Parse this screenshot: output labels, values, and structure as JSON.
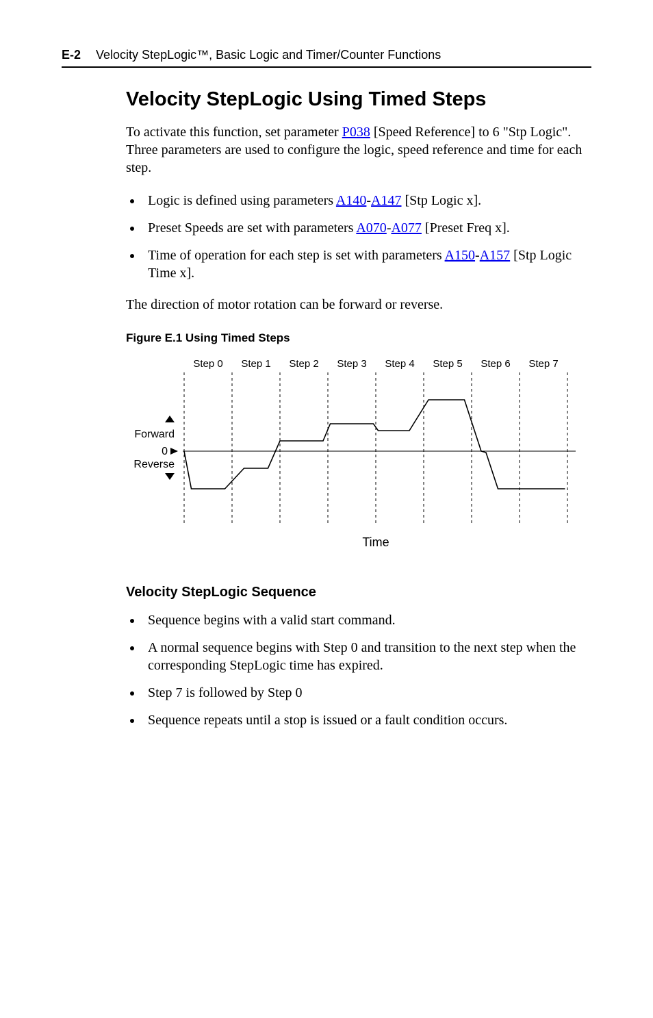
{
  "header": {
    "page_num": "E-2",
    "running_title": "Velocity StepLogic™, Basic Logic and Timer/Counter Functions"
  },
  "title": "Velocity StepLogic Using Timed Steps",
  "intro": {
    "pre": "To activate this function, set parameter ",
    "link1": "P038",
    "mid": " [Speed Reference] to 6 \"Stp Logic\". Three parameters are used to configure the logic, speed reference and time for each step."
  },
  "bullets1": {
    "b1_pre": "Logic is defined using parameters ",
    "b1_l1": "A140",
    "b1_dash1": "-",
    "b1_l2": "A147",
    "b1_post": " [Stp Logic x].",
    "b2_pre": "Preset Speeds are set with parameters ",
    "b2_l1": "A070",
    "b2_dash1": "-",
    "b2_l2": "A077",
    "b2_post": " [Preset Freq x].",
    "b3_pre": "Time of operation for each step is set with parameters ",
    "b3_l1": "A150",
    "b3_dash1": "-",
    "b3_l2": "A157",
    "b3_post": " [Stp Logic Time x]."
  },
  "direction_note": "The direction of motor rotation can be forward or reverse.",
  "figcap": "Figure E.1  Using Timed Steps",
  "chart_data": {
    "type": "line",
    "x_label": "Time",
    "y_labels": {
      "up": "Forward",
      "zero": "0",
      "down": "Reverse"
    },
    "steps": [
      "Step 0",
      "Step 1",
      "Step 2",
      "Step 3",
      "Step 4",
      "Step 5",
      "Step 6",
      "Step 7"
    ],
    "boundaries": [
      0,
      1,
      2,
      3,
      4,
      5,
      6,
      7,
      8
    ],
    "segments": [
      {
        "from": [
          0.0,
          0
        ],
        "to": [
          0.15,
          -55
        ]
      },
      {
        "from": [
          0.15,
          -55
        ],
        "to": [
          0.85,
          -55
        ]
      },
      {
        "from": [
          0.85,
          -55
        ],
        "to": [
          1.25,
          -25
        ]
      },
      {
        "from": [
          1.25,
          -25
        ],
        "to": [
          1.75,
          -25
        ]
      },
      {
        "from": [
          1.75,
          -25
        ],
        "to": [
          2.0,
          15
        ]
      },
      {
        "from": [
          2.0,
          15
        ],
        "to": [
          2.9,
          15
        ]
      },
      {
        "from": [
          2.9,
          15
        ],
        "to": [
          3.05,
          40
        ]
      },
      {
        "from": [
          3.05,
          40
        ],
        "to": [
          3.95,
          40
        ]
      },
      {
        "from": [
          3.95,
          40
        ],
        "to": [
          4.05,
          30
        ]
      },
      {
        "from": [
          4.05,
          30
        ],
        "to": [
          4.7,
          30
        ]
      },
      {
        "from": [
          4.7,
          30
        ],
        "to": [
          5.1,
          75
        ]
      },
      {
        "from": [
          5.1,
          75
        ],
        "to": [
          5.85,
          75
        ]
      },
      {
        "from": [
          5.85,
          75
        ],
        "to": [
          6.2,
          0
        ]
      },
      {
        "from": [
          6.2,
          0
        ],
        "to": [
          6.3,
          -2
        ]
      },
      {
        "from": [
          6.3,
          -2
        ],
        "to": [
          6.55,
          -55
        ]
      },
      {
        "from": [
          6.55,
          -55
        ],
        "to": [
          7.95,
          -55
        ]
      }
    ]
  },
  "subhead": "Velocity StepLogic Sequence",
  "bullets2": {
    "b1": "Sequence begins with a valid start command.",
    "b2": "A normal sequence begins with Step 0 and transition to the next step when the corresponding StepLogic time has expired.",
    "b3": "Step 7 is followed by Step 0",
    "b4": "Sequence repeats until a stop is issued or a fault condition occurs."
  }
}
